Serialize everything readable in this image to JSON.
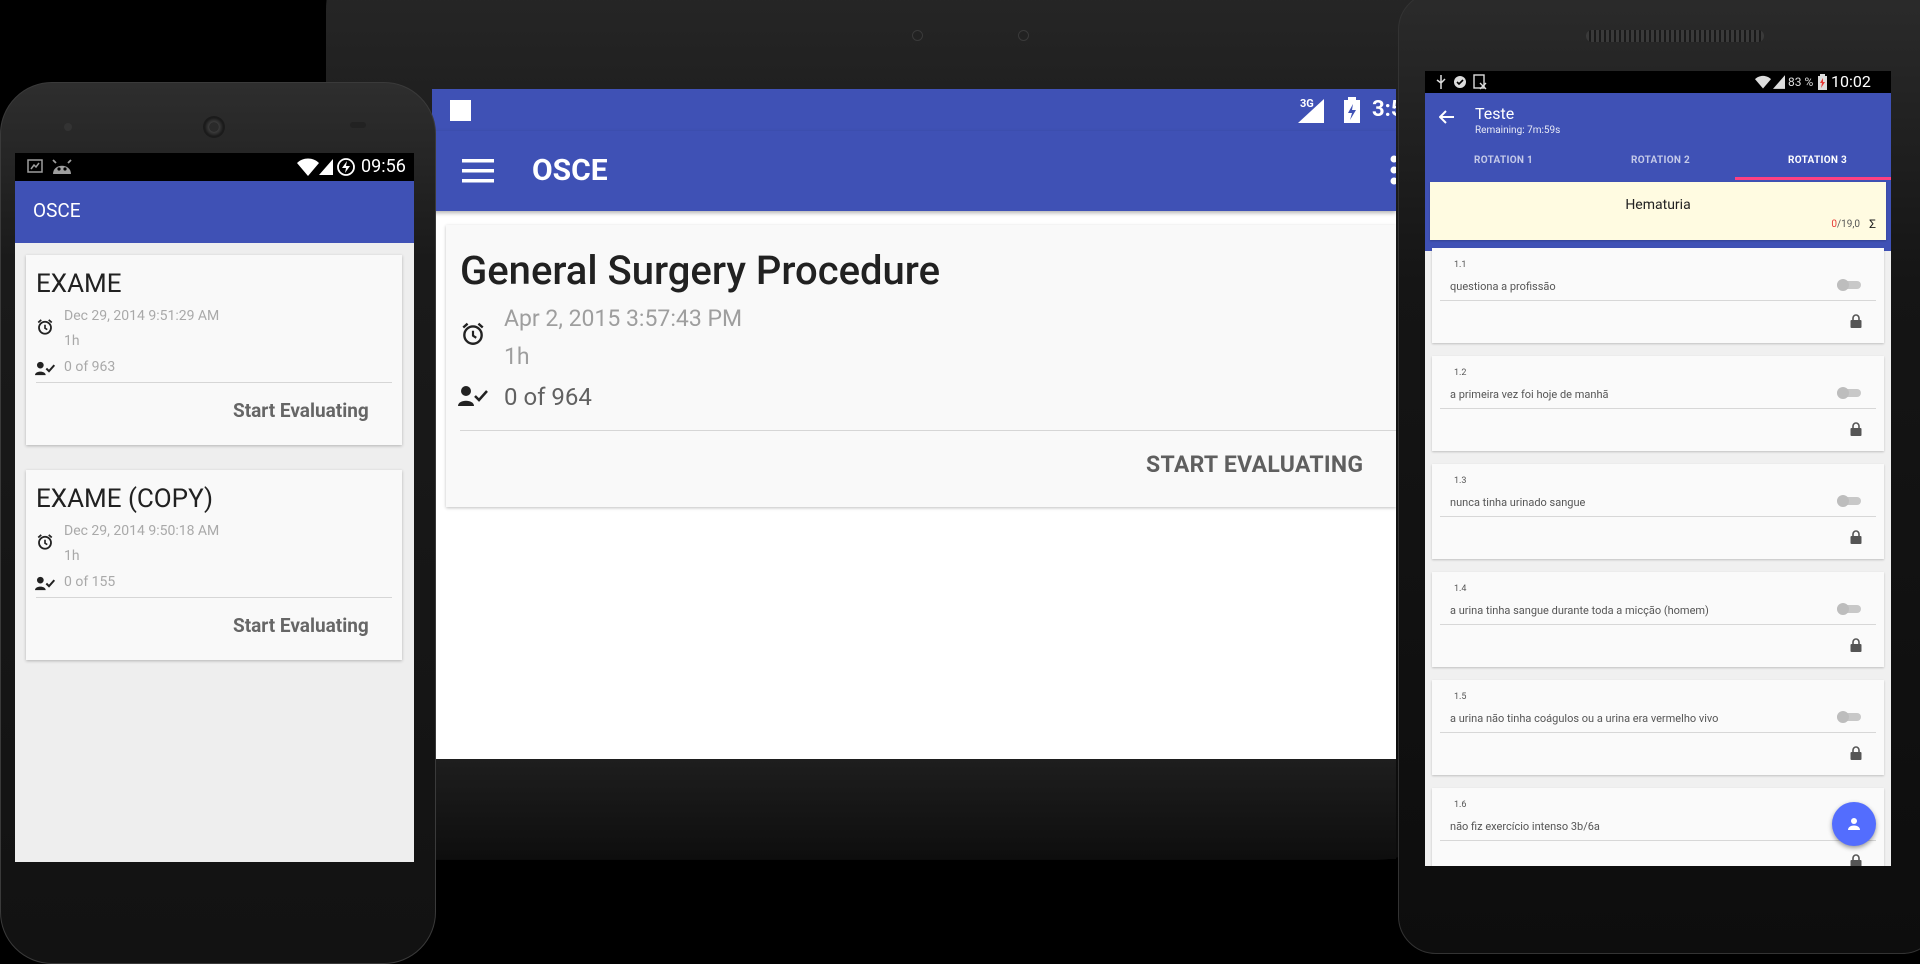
{
  "tablet": {
    "status_time": "3:5",
    "network": "3G",
    "app_title": "OSCE",
    "card": {
      "title": "General Surgery Procedure",
      "date": "Apr 2, 2015 3:57:43 PM",
      "duration": "1h",
      "count": "0 of 964",
      "button": "START EVALUATING"
    }
  },
  "small_phone": {
    "status_time": "09:56",
    "app_title": "OSCE",
    "cards": [
      {
        "title": "EXAME",
        "date": "Dec 29, 2014 9:51:29 AM",
        "duration": "1h",
        "count": "0 of 963",
        "button": "Start Evaluating"
      },
      {
        "title": "EXAME (COPY)",
        "date": "Dec 29, 2014 9:50:18 AM",
        "duration": "1h",
        "count": "0 of 155",
        "button": "Start Evaluating"
      }
    ]
  },
  "right_phone": {
    "status_time": "10:02",
    "battery": "83 %",
    "title": "Teste",
    "subtitle": "Remaining: 7m:59s",
    "tabs": [
      "ROTATION 1",
      "ROTATION 2",
      "ROTATION 3"
    ],
    "active_tab_index": 2,
    "summary": {
      "title": "Hematuria",
      "score_value": "0",
      "score_total": "/19,0",
      "sigma": "Σ"
    },
    "items": [
      {
        "number": "1.1",
        "text": "questiona a profissão"
      },
      {
        "number": "1.2",
        "text": "a primeira vez foi hoje de manhã"
      },
      {
        "number": "1.3",
        "text": "nunca tinha urinado sangue"
      },
      {
        "number": "1.4",
        "text": "a urina tinha sangue durante toda a micção (homem)"
      },
      {
        "number": "1.5",
        "text": "a urina não tinha coágulos ou a urina era vermelho vivo"
      },
      {
        "number": "1.6",
        "text": "não fiz exercício intenso 3b/6a"
      }
    ]
  },
  "colors": {
    "primary": "#3f51b5",
    "accent": "#ff4081",
    "fab": "#536dfe"
  }
}
